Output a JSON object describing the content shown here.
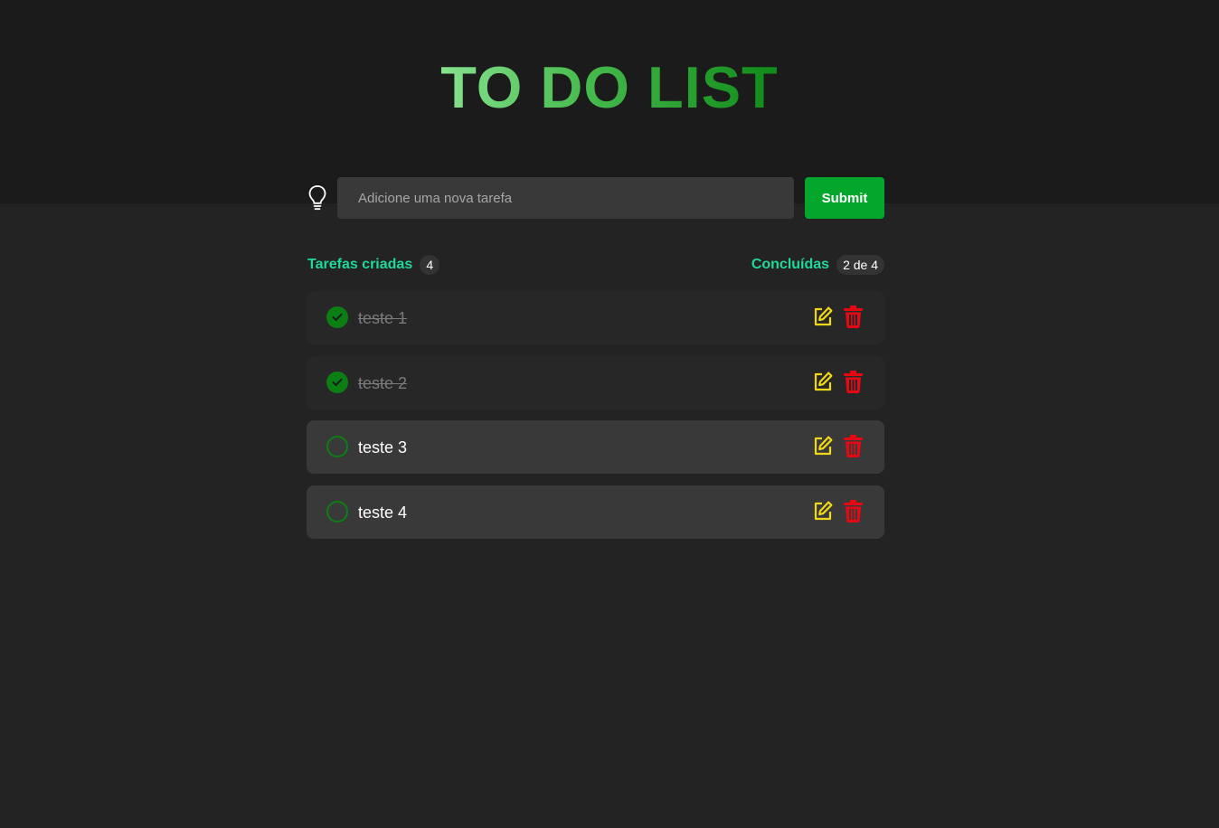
{
  "app": {
    "title": "TO DO LIST"
  },
  "form": {
    "placeholder": "Adicione uma nova tarefa",
    "submit_label": "Submit",
    "icon": "lightbulb-icon"
  },
  "stats": {
    "created_label": "Tarefas criadas",
    "created_count": "4",
    "completed_label": "Concluídas",
    "completed_count": "2 de 4"
  },
  "tasks": [
    {
      "text": "teste 1",
      "done": true
    },
    {
      "text": "teste 2",
      "done": true
    },
    {
      "text": "teste 3",
      "done": false
    },
    {
      "text": "teste 4",
      "done": false
    }
  ],
  "icons": {
    "edit": "edit-icon",
    "delete": "trash-icon",
    "check": "check-icon"
  },
  "colors": {
    "accent_green": "#05a62c",
    "label_teal": "#1fd89a",
    "edit_yellow": "#f1d718",
    "delete_red": "#e50914",
    "check_green": "#0c7f14"
  }
}
